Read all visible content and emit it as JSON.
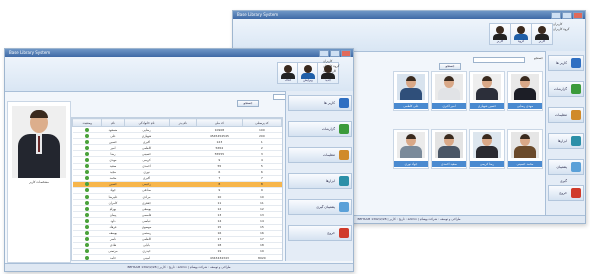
{
  "back_window": {
    "title": "Base Library System",
    "ribbon_tab": "كاربران",
    "tools": [
      "کاربر",
      "گروه",
      "كاربر",
      "جستجو"
    ],
    "tree": [
      "كاربران",
      "گروه كاربران"
    ],
    "search_label": "جستجو",
    "search_button": "جستجو",
    "cards": [
      {
        "name": "مهدی رضایی",
        "photo_bg": "#e9e9e9",
        "suit": "#1c1e26"
      },
      {
        "name": "حسین شهبازی",
        "photo_bg": "#eeeeee",
        "suit": "#2c2f3a"
      },
      {
        "name": "امیر اکبری",
        "photo_bg": "#eaeaea",
        "suit": "#e1e3e6"
      },
      {
        "name": "علی کاظمی",
        "photo_bg": "#d8e3ee",
        "suit": "#2f4f7a"
      },
      {
        "name": "محمد حسینی",
        "photo_bg": "#e6e6e6",
        "suit": "#6b4a2a"
      },
      {
        "name": "رضا کریمی",
        "photo_bg": "#dde6ee",
        "suit": "#2a2a30"
      },
      {
        "name": "سعید احمدی",
        "photo_bg": "#e3e3e3",
        "suit": "#4a5666"
      },
      {
        "name": "جواد نوری",
        "photo_bg": "#ebebeb",
        "suit": "#7a8a9a"
      }
    ],
    "sidebar": [
      {
        "label": "كاربر ها",
        "color": "#2f6fc2"
      },
      {
        "label": "گزارشات",
        "color": "#3b9b3b"
      },
      {
        "label": "تنظیمات",
        "color": "#d08a2a"
      },
      {
        "label": "ابزارها",
        "color": "#2b8fa8"
      },
      {
        "label": "پشتیبان گیری",
        "color": "#5aa0d8"
      },
      {
        "label": "خروج",
        "color": "#d03a2a"
      }
    ],
    "status": "BEHSAM    1392/2/28 | تاریخ :    کاربر : admin    |  طراحی و توسعه : شرکت بهسام"
  },
  "front_window": {
    "title": "Base Library System",
    "tools": [
      "حذف",
      "ویرایش",
      "جدید",
      "جستجو"
    ],
    "tree": [
      "كاربران",
      "گروه كاربران",
      "کاربر جدید"
    ],
    "filter_label": "جستجو",
    "filter_button": "جستجو",
    "columns": [
      "وضعیت",
      "نام",
      "نام خانوادگی",
      "نام پدر",
      "کد ملی",
      "کد پرسنلی"
    ],
    "rows": [
      [
        "مسعود",
        "رضایی",
        "",
        "10908",
        "100"
      ],
      [
        "علی",
        "شهبازی",
        "",
        "4545454545",
        "200"
      ],
      [
        "حسین",
        "اکبری",
        "",
        "123",
        "1"
      ],
      [
        "امیر",
        "کاظمی",
        "",
        "5654",
        "2"
      ],
      [
        "رضا",
        "حسینی",
        "",
        "55555",
        "3"
      ],
      [
        "مهدی",
        "کریمی",
        "",
        "9",
        "4"
      ],
      [
        "سعید",
        "احمدی",
        "",
        "55",
        "5"
      ],
      [
        "مجید",
        "نوری",
        "",
        "6",
        "6"
      ],
      [
        "محمد",
        "اکبری",
        "",
        "7",
        "7"
      ],
      [
        "حسین",
        "رحیمی",
        "",
        "8",
        "8"
      ],
      [
        "جواد",
        "صادقی",
        "",
        "9",
        "9"
      ],
      [
        "علیرضا",
        "مرادی",
        "",
        "10",
        "10"
      ],
      [
        "کامران",
        "جعفری",
        "",
        "11",
        "11"
      ],
      [
        "بهرام",
        "یوسفی",
        "",
        "12",
        "12"
      ],
      [
        "پیمان",
        "قاسمی",
        "",
        "13",
        "13"
      ],
      [
        "داود",
        "عباسی",
        "",
        "14",
        "14"
      ],
      [
        "فرهاد",
        "موسوی",
        "",
        "15",
        "15"
      ],
      [
        "یوسف",
        "رستمی",
        "",
        "16",
        "16"
      ],
      [
        "ناصر",
        "کاظمی",
        "",
        "17",
        "17"
      ],
      [
        "هادی",
        "بابایی",
        "",
        "18",
        "18"
      ],
      [
        "مرتضی",
        "حیدری",
        "",
        "19",
        "19"
      ],
      [
        "حامد",
        "امینی",
        "",
        "4343434343",
        "8020"
      ],
      [
        "سجاد",
        "نجفی",
        "",
        "7654321",
        "12345601"
      ]
    ],
    "highlight_row": 9,
    "detail": {
      "caption": "مشخصات کاربر",
      "fields": [
        "نام",
        "نام خانوادگی",
        "کد پرسنلی"
      ]
    },
    "sidebar": [
      {
        "label": "كاربر ها",
        "color": "#2f6fc2"
      },
      {
        "label": "گزارشات",
        "color": "#3b9b3b"
      },
      {
        "label": "تنظیمات",
        "color": "#d08a2a"
      },
      {
        "label": "ابزارها",
        "color": "#2b8fa8"
      },
      {
        "label": "پشتیبان گیری",
        "color": "#5aa0d8"
      },
      {
        "label": "خروج",
        "color": "#d03a2a"
      }
    ],
    "status": "BEHSAM    1392/2/28 | تاریخ :    کاربر : admin    |  طراحی و توسعه : شرکت بهسام"
  }
}
